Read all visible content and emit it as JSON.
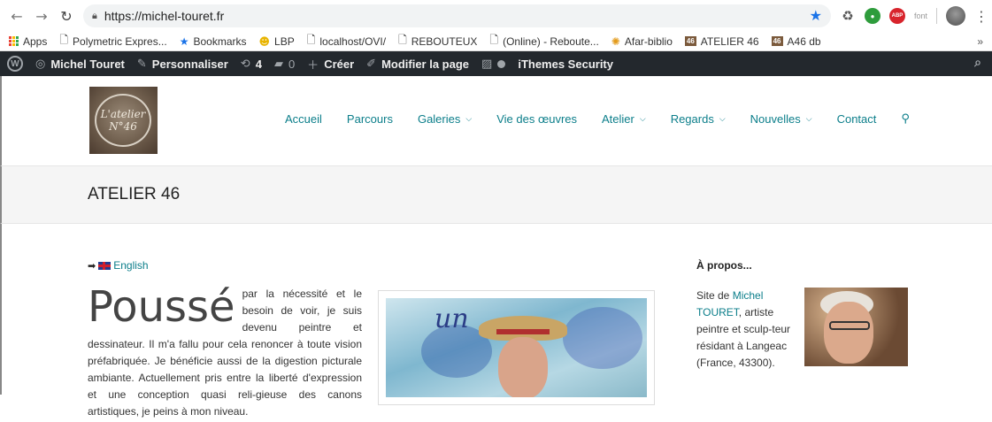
{
  "browser": {
    "url": "https://michel-touret.fr",
    "extension_font_label": "font",
    "bookmarks": [
      {
        "label": "Apps",
        "icon": "apps-grid-icon"
      },
      {
        "label": "Polymetric Expres...",
        "icon": "page-icon"
      },
      {
        "label": "Bookmarks",
        "icon": "star-icon"
      },
      {
        "label": "LBP",
        "icon": "smiley-icon"
      },
      {
        "label": "localhost/OVI/",
        "icon": "page-icon"
      },
      {
        "label": "REBOUTEUX",
        "icon": "page-icon"
      },
      {
        "label": "(Online) - Reboute...",
        "icon": "page-icon"
      },
      {
        "label": "Afar-biblio",
        "icon": "sun-icon"
      },
      {
        "label": "ATELIER 46",
        "icon": "a46-icon",
        "badge": "46"
      },
      {
        "label": "A46 db",
        "icon": "a46-icon",
        "badge": "46"
      }
    ],
    "more": "»"
  },
  "adminbar": {
    "site_name": "Michel Touret",
    "customize": "Personnaliser",
    "updates_count": "4",
    "comments_count": "0",
    "new": "Créer",
    "edit_page": "Modifier la page",
    "security": "iThemes Security"
  },
  "header": {
    "logo_line1": "L'atelier",
    "logo_line2": "N°46",
    "menu": [
      {
        "label": "Accueil",
        "dropdown": false
      },
      {
        "label": "Parcours",
        "dropdown": false
      },
      {
        "label": "Galeries",
        "dropdown": true
      },
      {
        "label": "Vie des œuvres",
        "dropdown": false
      },
      {
        "label": "Atelier",
        "dropdown": true
      },
      {
        "label": "Regards",
        "dropdown": true
      },
      {
        "label": "Nouvelles",
        "dropdown": true
      },
      {
        "label": "Contact",
        "dropdown": false
      }
    ]
  },
  "page": {
    "title": "ATELIER 46",
    "language_link": "English",
    "dropcap": "Poussé",
    "body": "par la nécessité et le besoin de voir, je suis devenu peintre et dessinateur. Il m'a fallu pour cela renoncer à toute vision préfabriquée. Je bénéficie aussi de la digestion picturale ambiante. Actuellement pris entre la liberté d'expression et une conception quasi reli-gieuse des canons artistiques, je peins à mon niveau."
  },
  "sidebar": {
    "widget_title": "À propos...",
    "about_prefix": "Site de ",
    "about_link": "Michel TOURET",
    "about_rest": ", artiste peintre et sculp-teur résidant à Langeac (France, 43300)."
  },
  "colors": {
    "link": "#0b7e8a",
    "adminbar": "#23282d",
    "title_bar_bg": "#f5f5f5"
  }
}
